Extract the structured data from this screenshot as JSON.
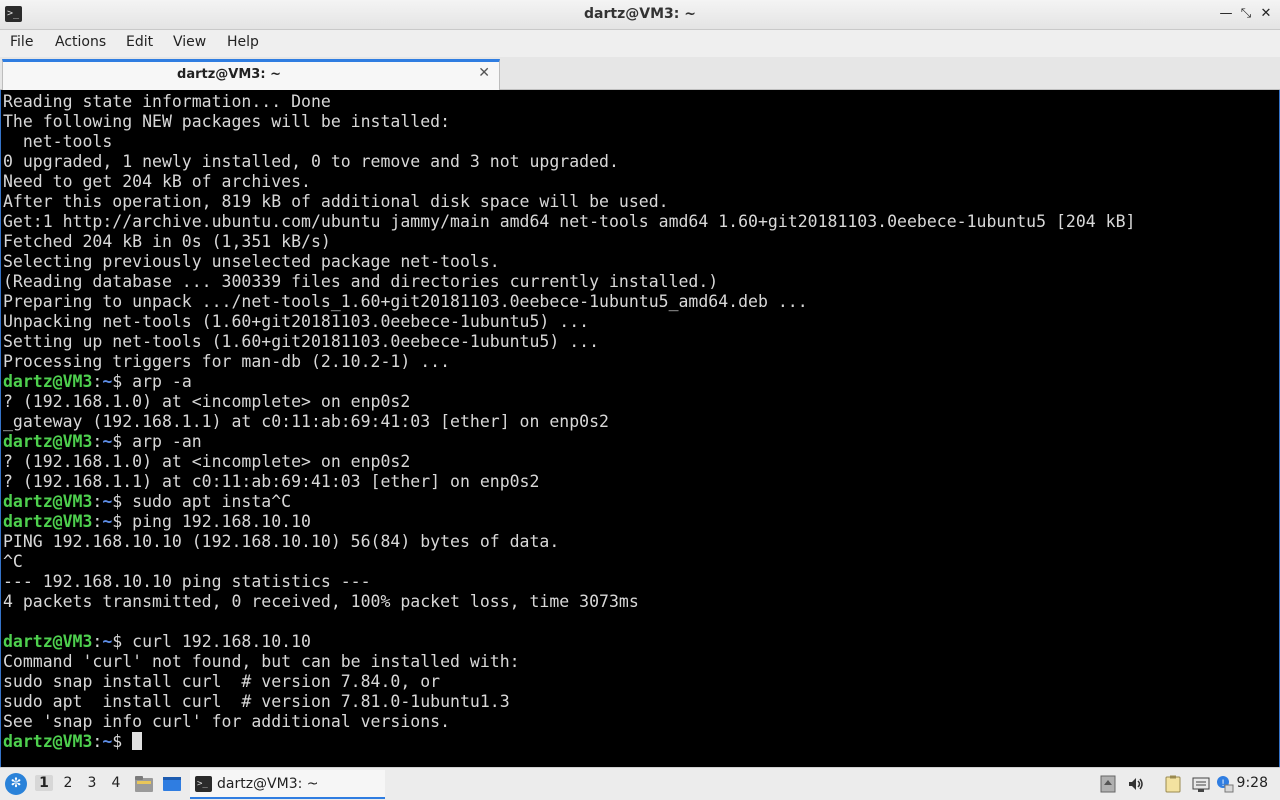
{
  "window": {
    "title": "dartz@VM3: ~"
  },
  "menu": [
    "File",
    "Actions",
    "Edit",
    "View",
    "Help"
  ],
  "tab": {
    "label": "dartz@VM3: ~",
    "close": "✕"
  },
  "terminal": {
    "prompt_user": "dartz@VM3",
    "prompt_path": "~",
    "lines": [
      {
        "text": "Reading state information... Done"
      },
      {
        "text": "The following NEW packages will be installed:"
      },
      {
        "text": "  net-tools"
      },
      {
        "text": "0 upgraded, 1 newly installed, 0 to remove and 3 not upgraded."
      },
      {
        "text": "Need to get 204 kB of archives."
      },
      {
        "text": "After this operation, 819 kB of additional disk space will be used."
      },
      {
        "text": "Get:1 http://archive.ubuntu.com/ubuntu jammy/main amd64 net-tools amd64 1.60+git20181103.0eebece-1ubuntu5 [204 kB]"
      },
      {
        "text": "Fetched 204 kB in 0s (1,351 kB/s)"
      },
      {
        "text": "Selecting previously unselected package net-tools."
      },
      {
        "text": "(Reading database ... 300339 files and directories currently installed.)"
      },
      {
        "text": "Preparing to unpack .../net-tools_1.60+git20181103.0eebece-1ubuntu5_amd64.deb ..."
      },
      {
        "text": "Unpacking net-tools (1.60+git20181103.0eebece-1ubuntu5) ..."
      },
      {
        "text": "Setting up net-tools (1.60+git20181103.0eebece-1ubuntu5) ..."
      },
      {
        "text": "Processing triggers for man-db (2.10.2-1) ..."
      },
      {
        "cmd": "arp -a"
      },
      {
        "text": "? (192.168.1.0) at <incomplete> on enp0s2"
      },
      {
        "text": "_gateway (192.168.1.1) at c0:11:ab:69:41:03 [ether] on enp0s2"
      },
      {
        "cmd": "arp -an"
      },
      {
        "text": "? (192.168.1.0) at <incomplete> on enp0s2"
      },
      {
        "text": "? (192.168.1.1) at c0:11:ab:69:41:03 [ether] on enp0s2"
      },
      {
        "cmd": "sudo apt insta^C"
      },
      {
        "cmd": "ping 192.168.10.10"
      },
      {
        "text": "PING 192.168.10.10 (192.168.10.10) 56(84) bytes of data."
      },
      {
        "text": "^C"
      },
      {
        "text": "--- 192.168.10.10 ping statistics ---"
      },
      {
        "text": "4 packets transmitted, 0 received, 100% packet loss, time 3073ms"
      },
      {
        "text": ""
      },
      {
        "cmd": "curl 192.168.10.10"
      },
      {
        "text": "Command 'curl' not found, but can be installed with:"
      },
      {
        "text": "sudo snap install curl  # version 7.84.0, or"
      },
      {
        "text": "sudo apt  install curl  # version 7.81.0-1ubuntu1.3"
      },
      {
        "text": "See 'snap info curl' for additional versions."
      },
      {
        "cmd": "",
        "cursor": true
      }
    ]
  },
  "taskbar": {
    "workspaces": [
      "1",
      "2",
      "3",
      "4"
    ],
    "active_workspace": "1",
    "task_label": "dartz@VM3: ~",
    "clock": "9:28"
  },
  "colors": {
    "prompt_user": "#4ed04e",
    "prompt_path": "#5f8fe9",
    "terminal_bg": "#000000",
    "accent": "#2f7de1"
  },
  "icons": {
    "app": "terminal-icon",
    "minimize": "minimize-icon",
    "maximize": "maximize-icon",
    "close": "close-icon",
    "start": "start-menu-icon",
    "file_manager": "file-manager-icon",
    "show_desktop": "show-desktop-icon",
    "tray": [
      "removable-media-icon",
      "volume-icon",
      "clipboard-icon",
      "network-icon",
      "update-notifier-icon"
    ]
  }
}
